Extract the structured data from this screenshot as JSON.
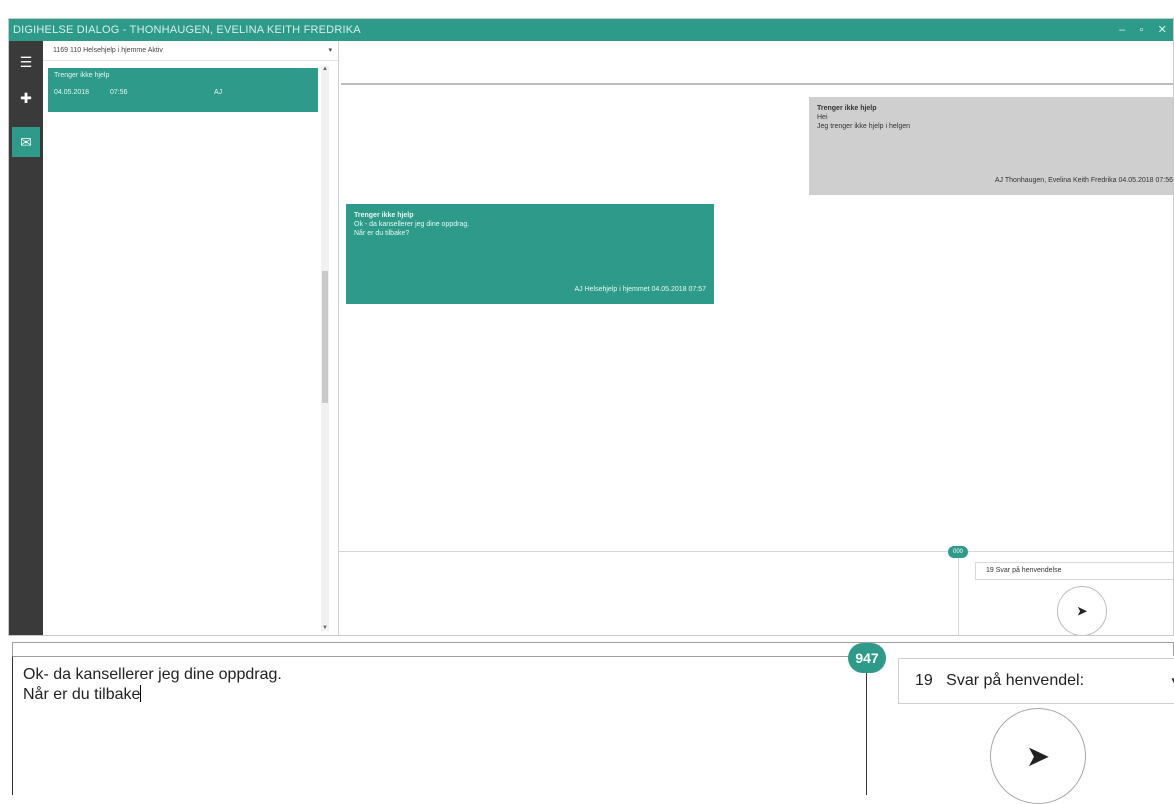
{
  "window": {
    "title": "DIGIHELSE DIALOG - THONHAUGEN, EVELINA KEITH FREDRIKA",
    "controls": [
      "–",
      "▫",
      "✕"
    ]
  },
  "rail": {
    "menu_icon": "☰",
    "add_icon": "✚",
    "messages_icon": "✉"
  },
  "filter": {
    "text": "1169   110   Helsehjelp i hjemme   Aktiv",
    "caret": "▾"
  },
  "conversation_item": {
    "title": "Trenger ikke hjelp",
    "date": "04.05.2018",
    "time": "07:56",
    "initials": "AJ"
  },
  "messages": [
    {
      "title": "Trenger ikke hjelp",
      "line1": "Hei",
      "line2": "Jeg trenger ikke hjelp i helgen",
      "meta": "AJ   Thonhaugen, Evelina Keith Fredrika     04.05.2018 07:56"
    },
    {
      "title": "Trenger ikke hjelp",
      "line1": "Ok - da kansellerer jeg dine oppdrag.",
      "line2": "Når er du tilbake?",
      "meta": "AJ   Helsehjelp i hjemmet     04.05.2018 07:57"
    }
  ],
  "composer_small": {
    "counter": "000",
    "category": "19   Svar på henvendelse",
    "send_icon": "➤"
  },
  "zoom": {
    "line1": "Ok- da kansellerer jeg dine oppdrag.",
    "line2": "Når er du tilbake",
    "counter": "947",
    "category_number": "19",
    "category_label": "Svar på henvendel:",
    "dropdown_icon": "▾",
    "send_icon": "➤"
  }
}
